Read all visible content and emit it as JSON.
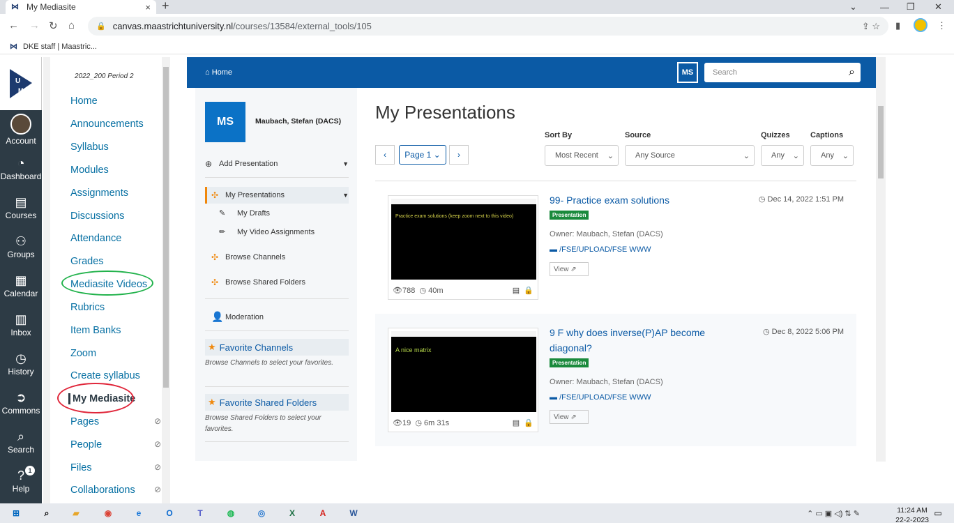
{
  "browser": {
    "tab_title": "My Mediasite",
    "tab_close": "×",
    "new_tab": "+",
    "url_host": "canvas.maastrichtuniversity.nl",
    "url_path": "/courses/13584/external_tools/105",
    "bookmark": "DKE staff | Maastric..."
  },
  "global_nav": {
    "items": [
      "Account",
      "Dashboard",
      "Courses",
      "Groups",
      "Calendar",
      "Inbox",
      "History",
      "Commons",
      "Search",
      "Help"
    ],
    "help_badge": "1"
  },
  "course_nav": {
    "term": "2022_200 Period 2",
    "items": [
      "Home",
      "Announcements",
      "Syllabus",
      "Modules",
      "Assignments",
      "Discussions",
      "Attendance",
      "Grades",
      "Mediasite Videos",
      "Rubrics",
      "Item Banks",
      "Zoom",
      "Create syllabus",
      "My Mediasite",
      "Pages",
      "People",
      "Files",
      "Collaborations"
    ]
  },
  "mediasite": {
    "home": "Home",
    "user_initials": "MS",
    "search_placeholder": "Search",
    "user_name": "Maubach, Stefan (DACS)",
    "add_presentation": "Add Presentation",
    "my_presentations": "My Presentations",
    "my_drafts": "My Drafts",
    "my_video_assignments": "My Video Assignments",
    "browse_channels": "Browse Channels",
    "browse_shared_folders": "Browse Shared Folders",
    "moderation": "Moderation",
    "favorite_channels": "Favorite Channels",
    "favorite_channels_note": "Browse Channels to select your favorites.",
    "favorite_folders": "Favorite Shared Folders",
    "favorite_folders_note": "Browse Shared Folders to select your favorites.",
    "page_title": "My Presentations",
    "pager": {
      "prev": "‹",
      "page": "Page 1",
      "next": "›"
    },
    "filters": {
      "sort_label": "Sort By",
      "sort_value": "Most Recent",
      "source_label": "Source",
      "source_value": "Any Source",
      "quizzes_label": "Quizzes",
      "quizzes_value": "Any",
      "captions_label": "Captions",
      "captions_value": "Any"
    },
    "presentations": [
      {
        "title": "99- Practice exam solutions",
        "badge": "Presentation",
        "owner": "Owner: Maubach, Stefan (DACS)",
        "folder": "/FSE/UPLOAD/FSE WWW",
        "view": "View",
        "date": "Dec 14, 2022 1:51 PM",
        "views": "788",
        "duration": "40m",
        "thumb_text": "Practice exam solutions (keep zoom next to this video)"
      },
      {
        "title": "9 F why does inverse(P)AP become diagonal?",
        "badge": "Presentation",
        "owner": "Owner: Maubach, Stefan (DACS)",
        "folder": "/FSE/UPLOAD/FSE WWW",
        "view": "View",
        "date": "Dec 8, 2022 5:06 PM",
        "views": "19",
        "duration": "6m 31s",
        "thumb_text": "A nice matrix"
      }
    ]
  },
  "taskbar": {
    "time": "11:24 AM",
    "date": "22-2-2023"
  }
}
